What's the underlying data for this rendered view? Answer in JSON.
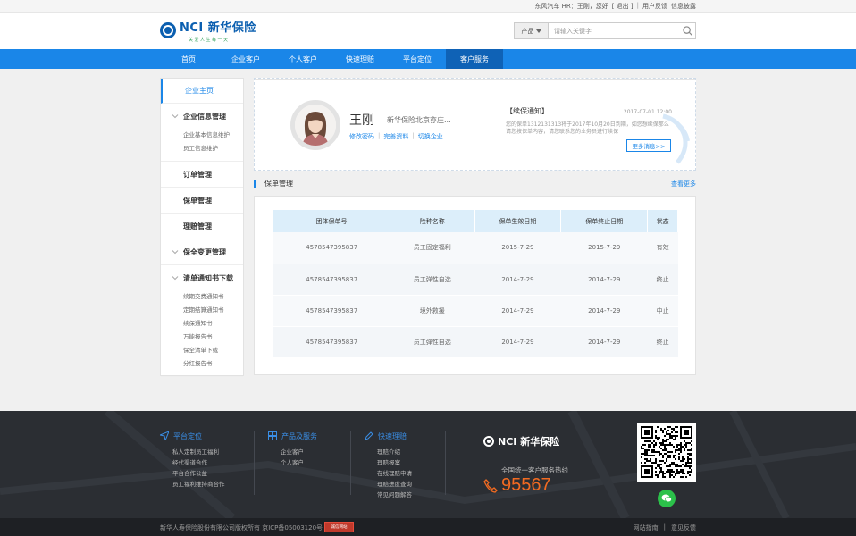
{
  "topbar": {
    "greeting": "东风汽车 HR：王刚，您好",
    "logout": "[ 退出 ]",
    "feedback": "用户反馈",
    "report": "信息披露"
  },
  "header": {
    "logo_title": "NCI 新华保险",
    "logo_slogan": "关爱人生每一天",
    "search_category": "产品",
    "search_placeholder": "请输入关键字"
  },
  "nav": {
    "items": [
      "首页",
      "企业客户",
      "个人客户",
      "快速理赔",
      "平台定位",
      "客户服务"
    ],
    "active_index": 5
  },
  "sidebar": {
    "home": "企业主页",
    "groups": [
      {
        "title": "企业信息管理",
        "chevron": true,
        "subs": [
          "企业基本信息维护",
          "员工信息维护"
        ]
      },
      {
        "title": "订单管理",
        "chevron": false,
        "subs": []
      },
      {
        "title": "保单管理",
        "chevron": false,
        "subs": []
      },
      {
        "title": "理赔管理",
        "chevron": false,
        "subs": []
      },
      {
        "title": "保全变更管理",
        "chevron": true,
        "subs": []
      },
      {
        "title": "清单通知书下载",
        "chevron": true,
        "subs": [
          "续期交费通知书",
          "定期结算通知书",
          "续保通知书",
          "万能报告书",
          "保全清单下载",
          "分红报告书"
        ]
      }
    ]
  },
  "profile": {
    "name": "王刚",
    "company": "新华保险北京亦庄...",
    "links": [
      "修改密码",
      "完善资料",
      "切换企业"
    ],
    "notice_title": "【续保通知】",
    "notice_date": "2017-07-01 12:00",
    "notice_text": "您的保单1312131313将于2017年10月20日到期，如您想续保那么请您按保单内容，请您联系您的业务员进行续保",
    "more_label": "更多消息>>"
  },
  "policy": {
    "title": "保单管理",
    "more": "查看更多",
    "columns": [
      "团体保单号",
      "险种名称",
      "保单生效日期",
      "保单终止日期",
      "状态"
    ],
    "rows": [
      [
        "4578547395837",
        "员工固定福利",
        "2015-7-29",
        "2015-7-29",
        "有效"
      ],
      [
        "4578547395837",
        "员工弹性自选",
        "2014-7-29",
        "2014-7-29",
        "终止"
      ],
      [
        "4578547395837",
        "境外救援",
        "2014-7-29",
        "2014-7-29",
        "中止"
      ],
      [
        "4578547395837",
        "员工弹性自选",
        "2014-7-29",
        "2014-7-29",
        "终止"
      ]
    ]
  },
  "footer": {
    "col1": {
      "title": "平台定位",
      "links": [
        "私人定制员工福利",
        "经代渠道合作",
        "平台合作公益",
        "员工福利维持商合作"
      ]
    },
    "col2": {
      "title": "产品及服务",
      "links": [
        "企业客户",
        "个人客户"
      ]
    },
    "col3": {
      "title": "快速理赔",
      "links": [
        "理赔介绍",
        "理赔报案",
        "在线理赔申请",
        "理赔进度查询",
        "常见问题解答"
      ]
    },
    "logo": "NCI 新华保险",
    "hotline_label": "全国统一客户服务热线",
    "hotline": "95567"
  },
  "bottom": {
    "copyright": "新华人寿保险股份有限公司版权所有  京ICP备05003120号",
    "badge": "诚信网站",
    "links": [
      "网站指南",
      "意见反馈"
    ]
  },
  "colors": {
    "brand": "#0b5fb0",
    "nav": "#1a86e8",
    "nav_active": "#0f62b6",
    "hotline": "#f36b21",
    "wechat": "#2bc14a"
  }
}
